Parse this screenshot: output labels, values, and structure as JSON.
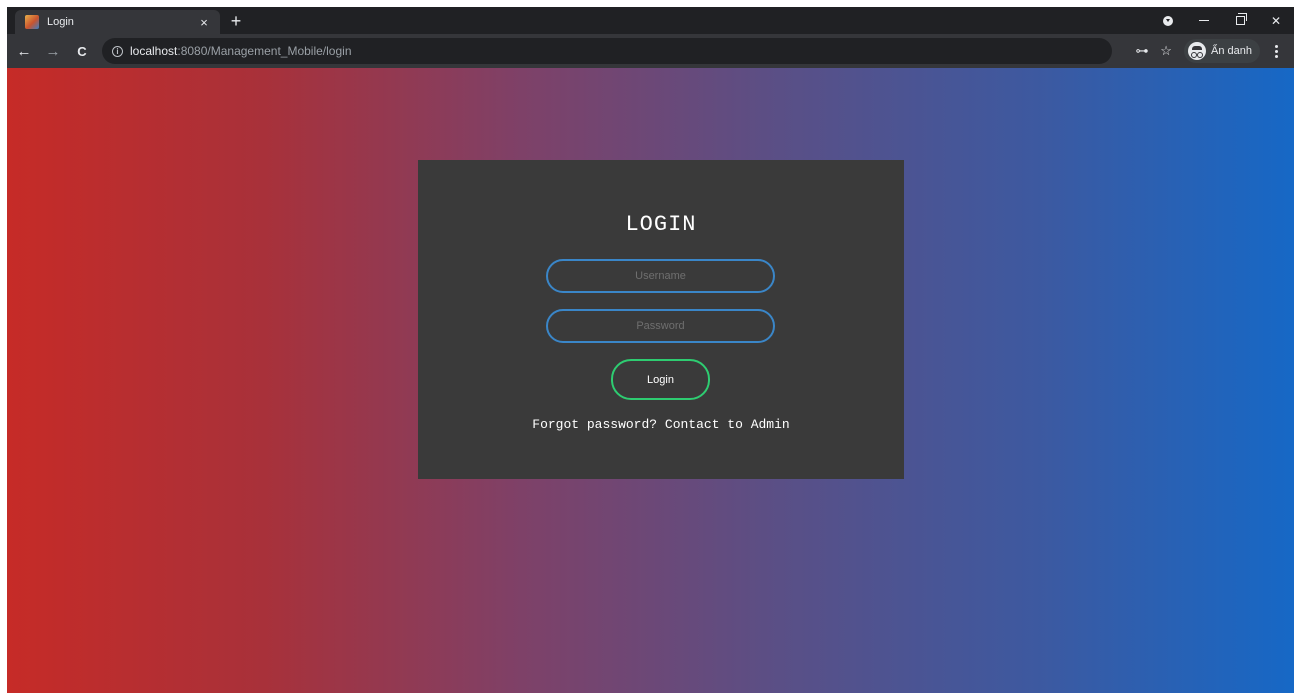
{
  "tab": {
    "title": "Login",
    "close_glyph": "×",
    "new_tab_glyph": "+"
  },
  "window_controls": {
    "minimize": "minimize-icon",
    "restore": "restore-icon",
    "close_glyph": "✕"
  },
  "toolbar": {
    "back_glyph": "←",
    "forward_glyph": "→",
    "reload_glyph": "C",
    "info_glyph": "i",
    "url_host": "localhost",
    "url_rest": ":8080/Management_Mobile/login",
    "key_glyph": "⊶",
    "star_glyph": "☆",
    "profile_label": "Ẩn danh"
  },
  "login": {
    "title": "LOGIN",
    "username_placeholder": "Username",
    "password_placeholder": "Password",
    "button_label": "Login",
    "forgot_text": "Forgot password? Contact to Admin"
  },
  "colors": {
    "gradient_start": "#c62b27",
    "gradient_end": "#1668c6",
    "card_bg": "#3a3a3a",
    "input_border": "#3a86c8",
    "button_border": "#2ecc71"
  }
}
